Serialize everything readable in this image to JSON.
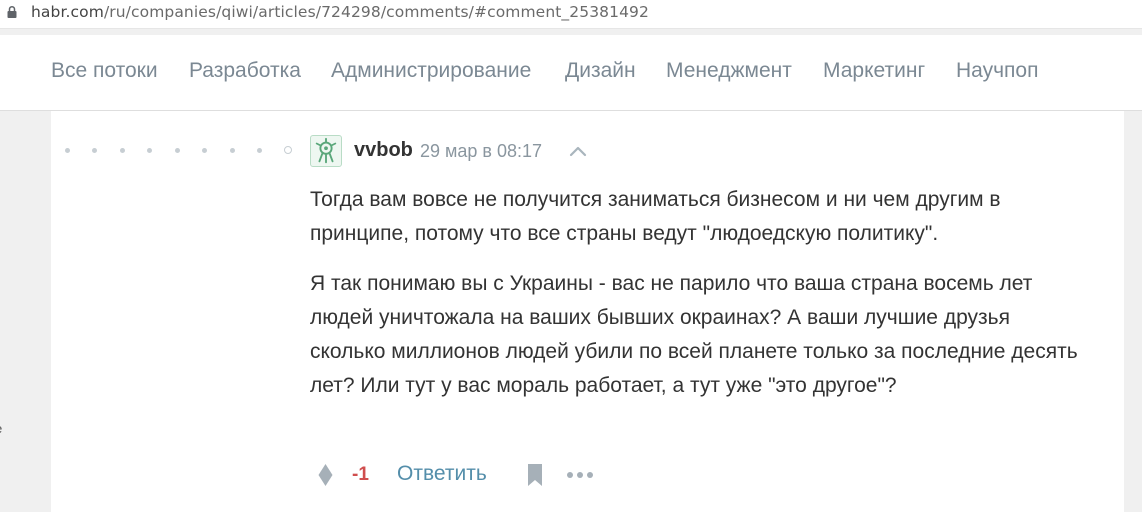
{
  "address_bar": {
    "domain": "habr.com",
    "path": "/ru/companies/qiwi/articles/724298/comments/#comment_25381492",
    "lock_icon": "lock-icon"
  },
  "nav": {
    "items": [
      {
        "label": "Все потоки"
      },
      {
        "label": "Разработка"
      },
      {
        "label": "Администрирование"
      },
      {
        "label": "Дизайн"
      },
      {
        "label": "Менеджмент"
      },
      {
        "label": "Маркетинг"
      },
      {
        "label": "Научпоп"
      }
    ]
  },
  "edge_fragment": "е",
  "comment": {
    "author": "vvbob",
    "timestamp": "29 мар в 08:17",
    "paragraphs": [
      "Тогда вам вовсе не получится заниматься бизнесом и ни чем другим в принципе, потому что все страны ведут \"людоедскую политику\".",
      "Я так понимаю вы с Украины - вас не парило что ваша страна восемь лет людей уничтожала на ваших бывших окраинах? А ваши лучшие друзья сколько миллионов людей убили по всей планете только за последние десять лет? Или тут у вас мораль работает, а тут уже \"это другое\"?"
    ],
    "score": "-1",
    "reply_label": "Ответить",
    "icons": {
      "avatar": "robot-avatar-icon",
      "parent": "chevron-up-icon",
      "vote": "vote-diamond-icon",
      "bookmark": "bookmark-icon",
      "more": "more-dots-icon"
    }
  },
  "colors": {
    "link": "#548eaa",
    "score_negative": "#d04e4e",
    "nav_text": "#7b8893",
    "avatar_green": "#5aa77a"
  }
}
